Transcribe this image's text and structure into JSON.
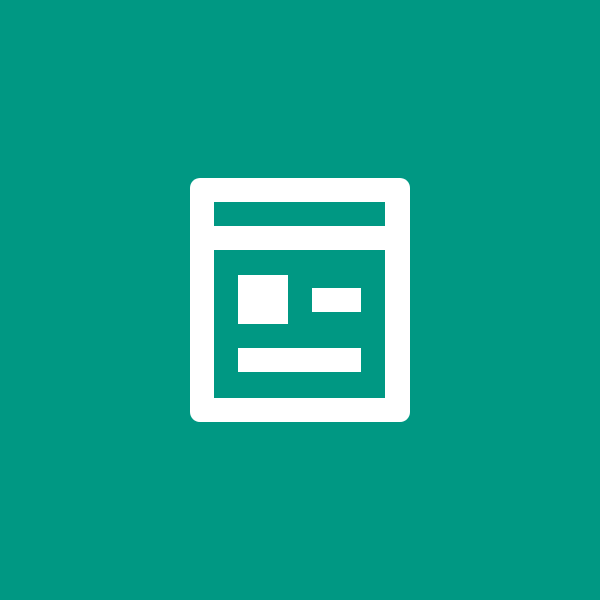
{
  "colors": {
    "background": "#009883",
    "foreground": "#ffffff"
  },
  "icon": {
    "name": "webpage-layout-icon"
  }
}
